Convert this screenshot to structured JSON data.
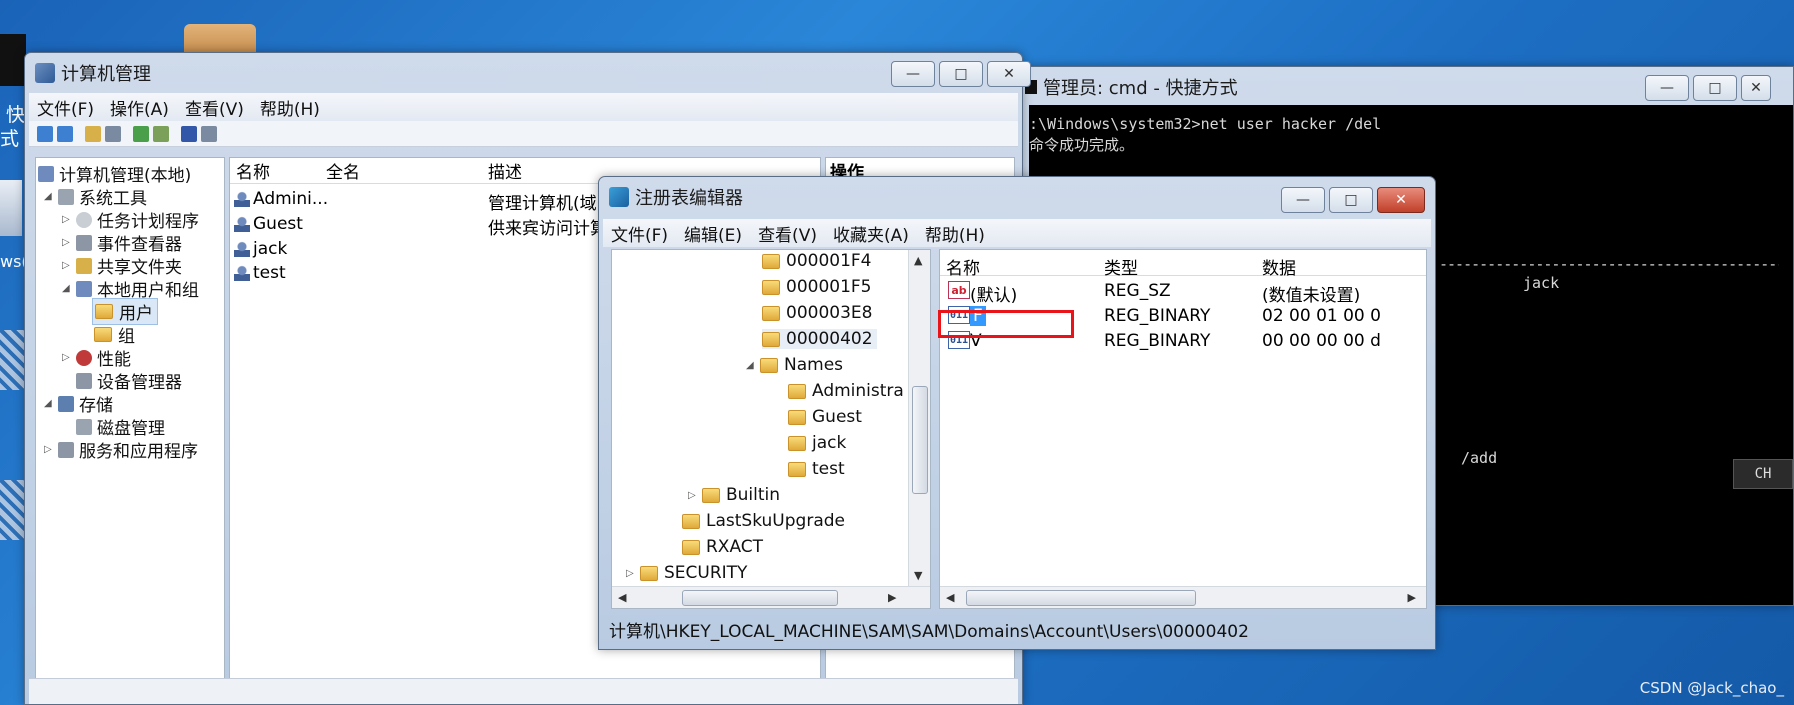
{
  "desktop": {
    "left_texts": [
      "快",
      "式",
      "ws("
    ],
    "watermark": "CSDN @Jack_chao_"
  },
  "computer_management": {
    "title": "计算机管理",
    "menu": [
      "文件(F)",
      "操作(A)",
      "查看(V)",
      "帮助(H)"
    ],
    "tree": {
      "root": "计算机管理(本地)",
      "system_tools": "系统工具",
      "task_scheduler": "任务计划程序",
      "event_viewer": "事件查看器",
      "shared_folders": "共享文件夹",
      "local_users": "本地用户和组",
      "users": "用户",
      "groups": "组",
      "performance": "性能",
      "device_manager": "设备管理器",
      "storage": "存储",
      "disk_management": "磁盘管理",
      "services_apps": "服务和应用程序"
    },
    "columns": [
      "名称",
      "全名",
      "描述"
    ],
    "users": [
      {
        "name": "Admini...",
        "desc": "管理计算机(域"
      },
      {
        "name": "Guest",
        "desc": "供来宾访问计算"
      },
      {
        "name": "jack",
        "desc": ""
      },
      {
        "name": "test",
        "desc": ""
      }
    ],
    "actions_header": "操作"
  },
  "cmd": {
    "title": "管理员: cmd - 快捷方式",
    "lines": [
      ":\\Windows\\system32>net user hacker /del",
      "命令成功完成。",
      "------------------------------------------------------------------",
      "jack",
      "/add"
    ],
    "ime": "CH"
  },
  "regedit": {
    "title": "注册表编辑器",
    "menu": [
      "文件(F)",
      "编辑(E)",
      "查看(V)",
      "收藏夹(A)",
      "帮助(H)"
    ],
    "tree": {
      "k1": "000001F4",
      "k2": "000001F5",
      "k3": "000003E8",
      "k4": "00000402",
      "names": "Names",
      "n1": "Administra",
      "n2": "Guest",
      "n3": "jack",
      "n4": "test",
      "builtin": "Builtin",
      "lastsku": "LastSkuUpgrade",
      "rxact": "RXACT",
      "security": "SECURITY"
    },
    "columns": [
      "名称",
      "类型",
      "数据"
    ],
    "values": [
      {
        "name": "(默认)",
        "type": "REG_SZ",
        "data": "(数值未设置)",
        "icon": "string-value-icon"
      },
      {
        "name": "F",
        "type": "REG_BINARY",
        "data": "02 00 01 00 0",
        "icon": "binary-value-icon"
      },
      {
        "name": "V",
        "type": "REG_BINARY",
        "data": "00 00 00 00 d",
        "icon": "binary-value-icon"
      }
    ],
    "status_path": "计算机\\HKEY_LOCAL_MACHINE\\SAM\\SAM\\Domains\\Account\\Users\\00000402",
    "highlight_color": "#e8141a"
  }
}
